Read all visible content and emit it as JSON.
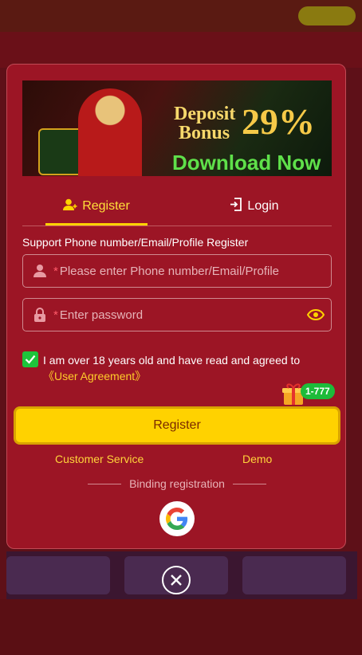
{
  "banner": {
    "line1": "Deposit",
    "line2": "Bonus",
    "percent": "29%",
    "cta": "Download Now"
  },
  "tabs": {
    "register": "Register",
    "login": "Login"
  },
  "form": {
    "support_label": "Support Phone number/Email/Profile Register",
    "required_mark": "*",
    "phone_placeholder": "Please enter Phone number/Email/Profile",
    "password_placeholder": "Enter password"
  },
  "agreement": {
    "checked": true,
    "text": "I am over 18 years old and have read and agreed to",
    "link": "《User Agreement》"
  },
  "promo": {
    "badge": "1-777"
  },
  "actions": {
    "register": "Register",
    "customer_service": "Customer Service",
    "demo": "Demo",
    "binding": "Binding registration"
  },
  "colors": {
    "modal_bg": "#9c1525",
    "accent_yellow": "#ffd200",
    "check_green": "#1dc43b"
  },
  "icons": [
    "add-user-icon",
    "login-icon",
    "user-icon",
    "lock-icon",
    "eye-icon",
    "check-icon",
    "gift-icon",
    "google-icon",
    "close-icon"
  ]
}
